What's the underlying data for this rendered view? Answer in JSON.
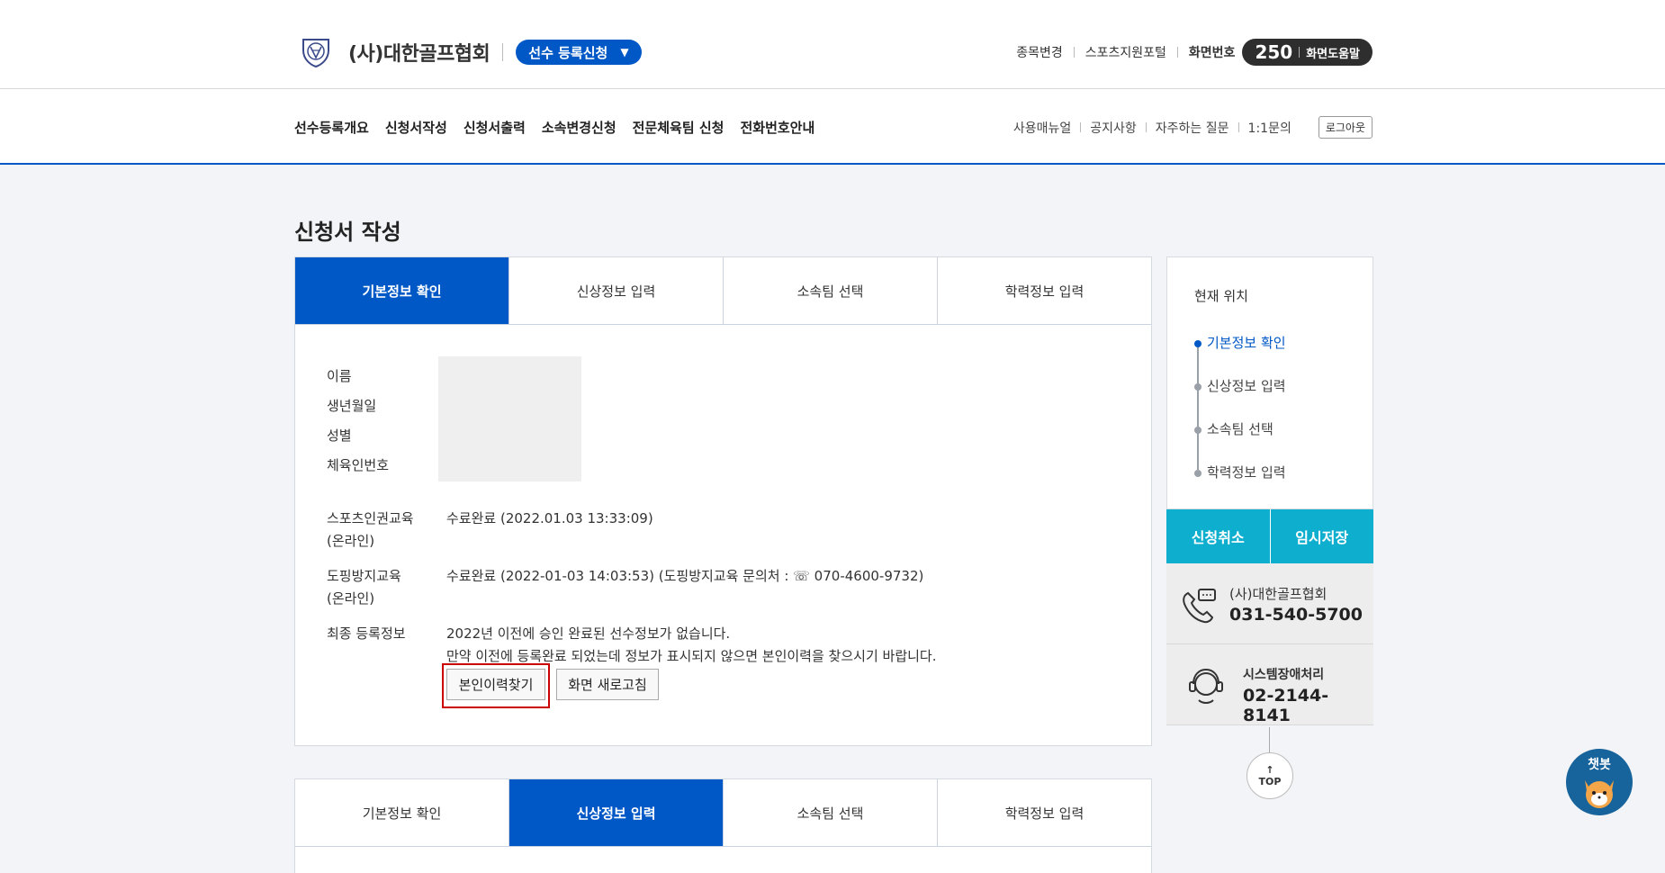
{
  "header": {
    "org_name": "(사)대한골프협회",
    "registration_pill": "선수 등록신청",
    "util_links": [
      "종목변경",
      "스포츠지원포털"
    ],
    "screen_number_label": "화면번호",
    "screen_number": "250",
    "screen_help": "화면도움말"
  },
  "nav": {
    "main": [
      "선수등록개요",
      "신청서작성",
      "신청서출력",
      "소속변경신청",
      "전문체육팀 신청",
      "전화번호안내"
    ],
    "sub": [
      "사용매뉴얼",
      "공지사항",
      "자주하는 질문",
      "1:1문의"
    ],
    "logout": "로그아웃"
  },
  "page_title": "신청서 작성",
  "panel1": {
    "tabs": [
      "기본정보 확인",
      "신상정보 입력",
      "소속팀 선택",
      "학력정보 입력"
    ],
    "active_tab": 0,
    "basic_labels": [
      "이름",
      "생년월일",
      "성별",
      "체육인번호"
    ],
    "human_rights_label": [
      "스포츠인권교육",
      "(온라인)"
    ],
    "human_rights_value": "수료완료 (2022.01.03 13:33:09)",
    "doping_label": [
      "도핑방지교육",
      "(온라인)"
    ],
    "doping_value": "수료완료 (2022-01-03 14:03:53) (도핑방지교육 문의처 : ☏ 070-4600-9732)",
    "final_reg_label": "최종 등록정보",
    "final_reg_line1": "2022년 이전에 승인 완료된 선수정보가 없습니다.",
    "final_reg_line2": "만약 이전에 등록완료 되었는데 정보가 표시되지 않으면 본인이력을 찾으시기 바랍니다.",
    "find_history_button": "본인이력찾기",
    "refresh_button": "화면 새로고침"
  },
  "panel2": {
    "tabs": [
      "기본정보 확인",
      "신상정보 입력",
      "소속팀 선택",
      "학력정보 입력"
    ],
    "active_tab": 1
  },
  "sidebar": {
    "location_title": "현재 위치",
    "steps": [
      "기본정보 확인",
      "신상정보 입력",
      "소속팀 선택",
      "학력정보 입력"
    ],
    "active_step": 0,
    "cancel_button": "신청취소",
    "save_button": "임시저장",
    "contact1_name": "(사)대한골프협회",
    "contact1_phone": "031-540-5700",
    "contact2_name": "시스템장애처리",
    "contact2_phone": "02-2144-8141",
    "top_label": "TOP"
  },
  "chatbot_label": "챗봇",
  "colors": {
    "primary": "#0058c6",
    "accent": "#0eaecf",
    "highlight": "#cc0000"
  }
}
